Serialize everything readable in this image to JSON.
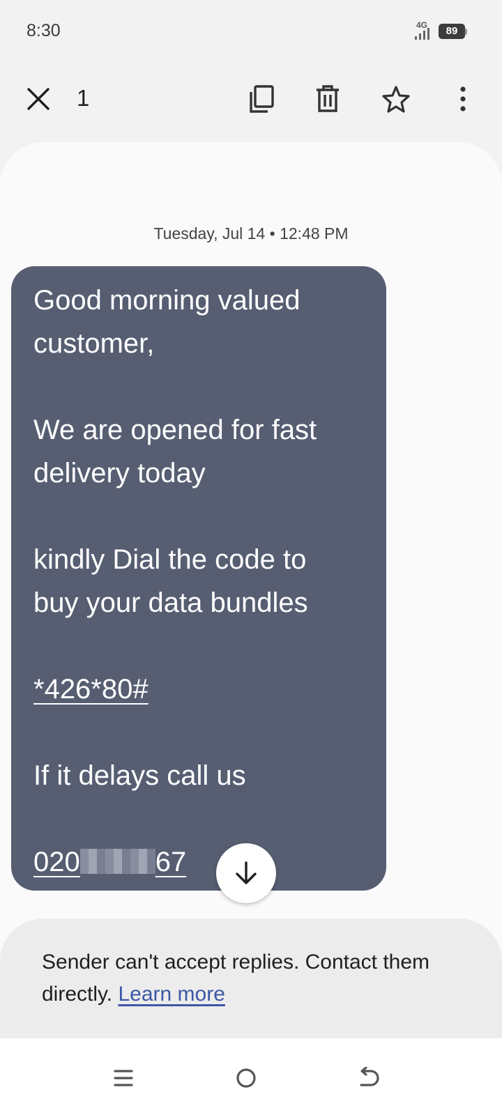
{
  "status_bar": {
    "time": "8:30",
    "network": "4G",
    "battery": "89"
  },
  "action_bar": {
    "selected_count": "1",
    "icons": [
      "close-icon",
      "copy-icon",
      "delete-icon",
      "star-icon",
      "more-vert-icon"
    ]
  },
  "conversation": {
    "timestamp": "Tuesday, Jul 14 • 12:48 PM",
    "message": {
      "line1": "Good morning valued",
      "line2": "customer,",
      "line3": "We are opened for fast",
      "line4": "delivery today",
      "line5": "kindly Dial the code to",
      "line6": "buy your data bundles",
      "ussd_code": "*426*80#",
      "line7": "If it delays call us",
      "phone_prefix": "020",
      "phone_suffix": "67"
    }
  },
  "reply_notice": {
    "text": "Sender can't accept replies. Contact them directly. ",
    "link": "Learn more"
  },
  "colors": {
    "bubble": "#575e72",
    "link": "#3c57a6"
  }
}
